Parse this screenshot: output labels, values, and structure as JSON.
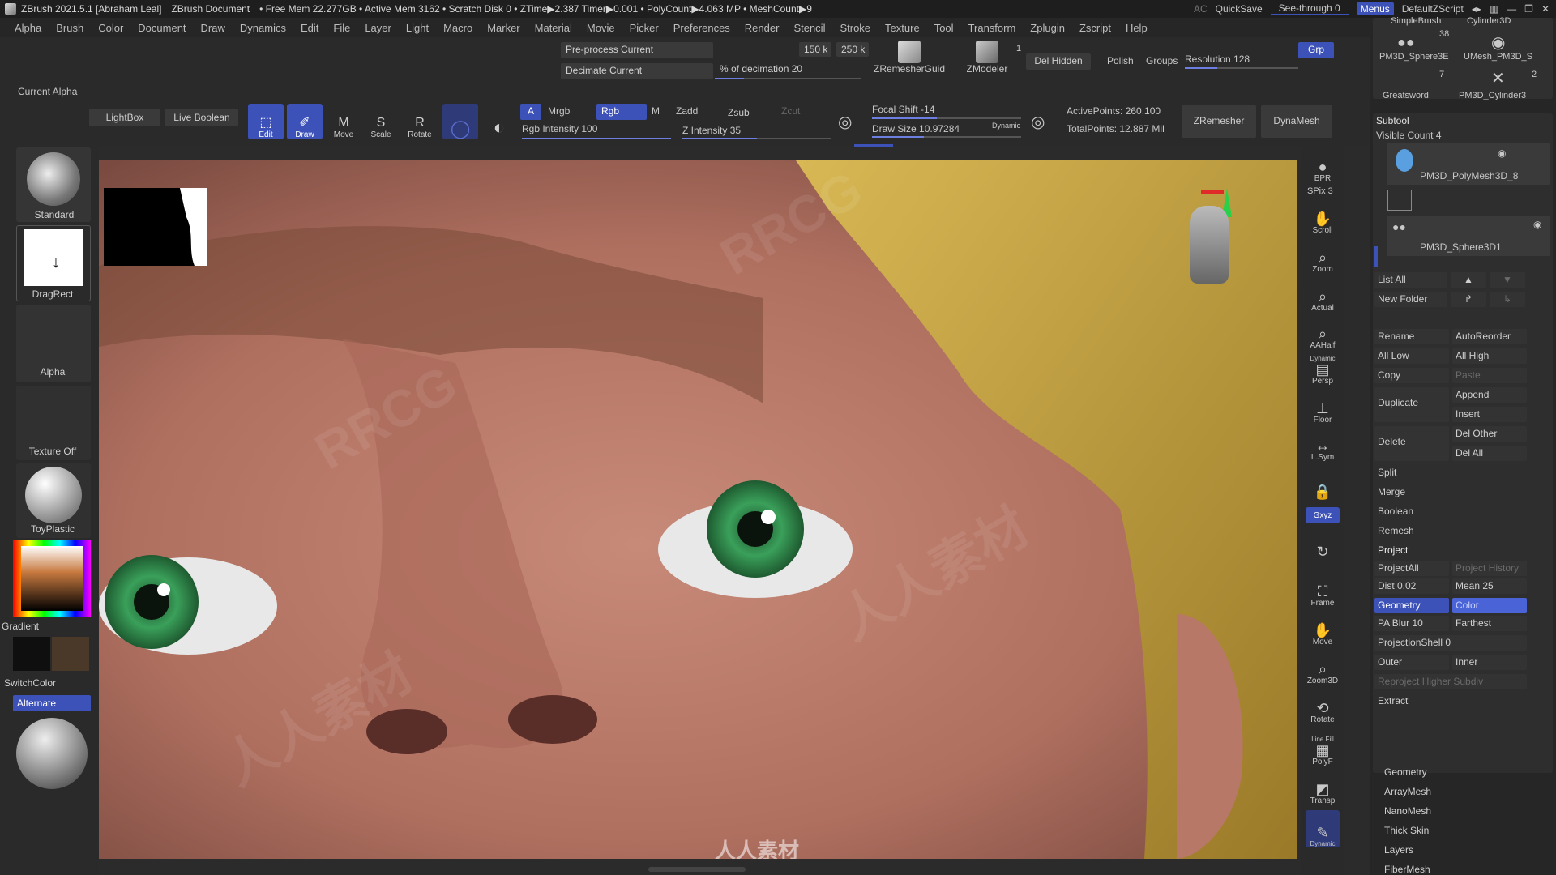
{
  "titlebar": {
    "app": "ZBrush 2021.5.1 [Abraham Leal]",
    "doc": "ZBrush Document",
    "stats": "• Free Mem 22.277GB • Active Mem 3162 • Scratch Disk 0 • ZTime▶2.387 Timer▶0.001 • PolyCount▶4.063 MP • MeshCount▶9",
    "ac": "AC",
    "quicksave": "QuickSave",
    "seethrough": "See-through 0",
    "menus": "Menus",
    "zscript": "DefaultZScript"
  },
  "menubar": [
    "Alpha",
    "Brush",
    "Color",
    "Document",
    "Draw",
    "Dynamics",
    "Edit",
    "File",
    "Layer",
    "Light",
    "Macro",
    "Marker",
    "Material",
    "Movie",
    "Picker",
    "Preferences",
    "Render",
    "Stencil",
    "Stroke",
    "Texture",
    "Tool",
    "Transform",
    "Zplugin",
    "Zscript",
    "Help"
  ],
  "shelf": {
    "current_alpha": "Current Alpha",
    "preprocess": "Pre-process Current",
    "decimate": "Decimate Current",
    "k150": "150 k",
    "k250": "250 k",
    "decimation": "% of decimation 20",
    "zremesher_guides": "ZRemesherGuid",
    "zmodeler": "ZModeler",
    "zmodeler_count": "1",
    "del_hidden": "Del Hidden",
    "polish": "Polish",
    "groups": "Groups",
    "resolution": "Resolution 128",
    "grp": "Grp",
    "lightbox": "LightBox",
    "live_boolean": "Live Boolean",
    "edit": "Edit",
    "draw": "Draw",
    "move": "Move",
    "scale": "Scale",
    "rotate": "Rotate",
    "a_btn": "A",
    "mrgb": "Mrgb",
    "rgb": "Rgb",
    "m": "M",
    "zadd": "Zadd",
    "zsub": "Zsub",
    "zcut": "Zcut",
    "rgb_intensity": "Rgb Intensity 100",
    "z_intensity": "Z Intensity 35",
    "focal_shift": "Focal Shift -14",
    "draw_size": "Draw Size 10.97284",
    "dynamic": "Dynamic",
    "active_points": "ActivePoints: 260,100",
    "total_points": "TotalPoints: 12.887 Mil",
    "zremesher": "ZRemesher",
    "dynamesh": "DynaMesh"
  },
  "left_tray": {
    "standard": "Standard",
    "dragrect": "DragRect",
    "alpha": "Alpha",
    "texture": "Texture Off",
    "material": "ToyPlastic",
    "gradient": "Gradient",
    "switchcolor": "SwitchColor",
    "alternate": "Alternate"
  },
  "right_tray": {
    "bpr": "BPR",
    "spix": "SPix 3",
    "scroll": "Scroll",
    "zoom": "Zoom",
    "actual": "Actual",
    "aahalf": "AAHalf",
    "persp": "Persp",
    "persp_top": "Dynamic",
    "floor": "Floor",
    "lsym": "L.Sym",
    "gxyz": "Gxyz",
    "frame": "Frame",
    "move": "Move",
    "zoom3d": "Zoom3D",
    "rotate": "Rotate",
    "linefill": "Line Fill",
    "polyf": "PolyF",
    "transp": "Transp",
    "solo": "Dynamic"
  },
  "tool_thumbs": {
    "simplebrush": "SimpleBrush",
    "cylinder3d": "Cylinder3D",
    "count38": "38",
    "sphere": "PM3D_Sphere3E",
    "umesh": "UMesh_PM3D_S",
    "count7": "7",
    "count2": "2",
    "greatsword": "Greatsword",
    "pm3dcyl": "PM3D_Cylinder3"
  },
  "subtool": {
    "title": "Subtool",
    "visible_count": "Visible Count 4",
    "item1": "PM3D_PolyMesh3D_8",
    "item2": "PM3D_Sphere3D1",
    "list_all": "List All",
    "new_folder": "New Folder",
    "rename": "Rename",
    "autoreorder": "AutoReorder",
    "all_low": "All Low",
    "all_high": "All High",
    "copy": "Copy",
    "paste": "Paste",
    "duplicate": "Duplicate",
    "append": "Append",
    "insert": "Insert",
    "delete": "Delete",
    "del_other": "Del Other",
    "del_all": "Del All",
    "split": "Split",
    "merge": "Merge",
    "boolean": "Boolean",
    "remesh": "Remesh",
    "project": "Project",
    "project_all": "ProjectAll",
    "project_history": "Project History",
    "dist": "Dist 0.02",
    "mean": "Mean 25",
    "geometry_btn": "Geometry",
    "color_btn": "Color",
    "pa_blur": "PA Blur 10",
    "farthest": "Farthest",
    "projection_shell": "ProjectionShell 0",
    "outer": "Outer",
    "inner": "Inner",
    "reproject": "Reproject Higher Subdiv",
    "extract": "Extract"
  },
  "tool_menu": [
    "Geometry",
    "ArrayMesh",
    "NanoMesh",
    "Thick Skin",
    "Layers",
    "FiberMesh"
  ],
  "watermark": {
    "brand": "RRCG",
    "cn": "人人素材"
  },
  "colors": {
    "accent": "#3d52b8",
    "skin": "#b57a6a",
    "hair": "#c9a441",
    "iris": "#2f8a4a"
  }
}
